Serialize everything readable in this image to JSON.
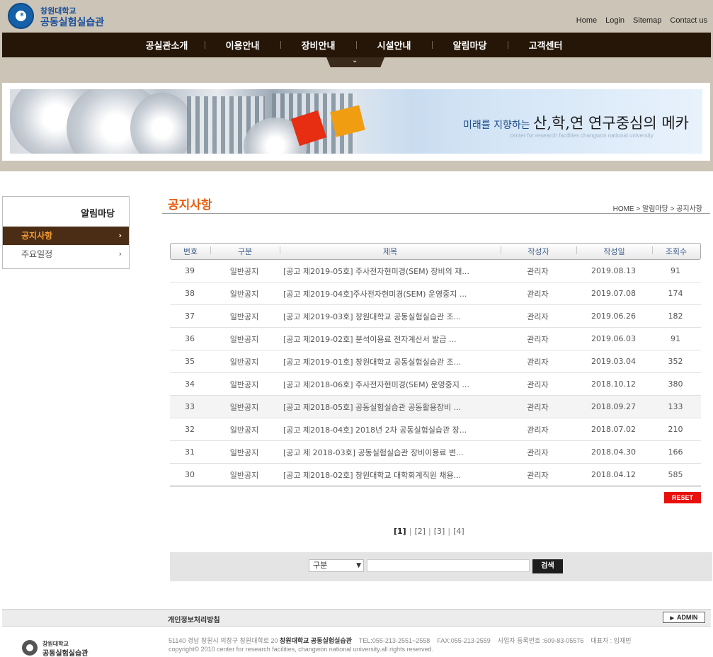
{
  "logo": {
    "line1": "창원대학교",
    "line2": "공동실험실습관"
  },
  "topnav": [
    "Home",
    "Login",
    "Sitemap",
    "Contact us"
  ],
  "gnb": [
    "공실관소개",
    "이용안내",
    "장비안내",
    "시설안내",
    "알림마당",
    "고객센터"
  ],
  "banner": {
    "slogan_small": "미래를 지향하는 ",
    "slogan_big": "산,학,연 연구중심의 메카",
    "sub": "center for research facilities changwon national university"
  },
  "lnb": {
    "title": "알림마당",
    "items": [
      "공지사항",
      "주요일정"
    ]
  },
  "page": {
    "title": "공지사항",
    "breadcrumb": "HOME > 알림마당 > 공지사항"
  },
  "board": {
    "headers": [
      "번호",
      "구분",
      "제목",
      "작성자",
      "작성일",
      "조회수"
    ],
    "rows": [
      [
        "39",
        "일반공지",
        "[공고 제2019-05호] 주사전자현미경(SEM) 장비의 재...",
        "관리자",
        "2019.08.13",
        "91"
      ],
      [
        "38",
        "일반공지",
        "[공고 제2019-04호]주사전자현미경(SEM) 운영중지 ...",
        "관리자",
        "2019.07.08",
        "174"
      ],
      [
        "37",
        "일반공지",
        "[공고 제2019-03호] 창원대학교 공동실험실습관 조...",
        "관리자",
        "2019.06.26",
        "182"
      ],
      [
        "36",
        "일반공지",
        "[공고 제2019-02호] 분석이용료 전자계산서 발급 ...",
        "관리자",
        "2019.06.03",
        "91"
      ],
      [
        "35",
        "일반공지",
        "[공고 제2019-01호] 창원대학교 공동실험실습관 조...",
        "관리자",
        "2019.03.04",
        "352"
      ],
      [
        "34",
        "일반공지",
        "[공고 제2018-06호] 주사전자현미경(SEM) 운영중지 ...",
        "관리자",
        "2018.10.12",
        "380"
      ],
      [
        "33",
        "일반공지",
        "[공고 제2018-05호] 공동실험실습관 공동활용장비 ...",
        "관리자",
        "2018.09.27",
        "133"
      ],
      [
        "32",
        "일반공지",
        "[공고 제2018-04호] 2018년 2차 공동실험실습관 장...",
        "관리자",
        "2018.07.02",
        "210"
      ],
      [
        "31",
        "일반공지",
        "[공고 제 2018-03호] 공동실험실습관 장비이용료 변...",
        "관리자",
        "2018.04.30",
        "166"
      ],
      [
        "30",
        "일반공지",
        "[공고 제2018-02호] 창원대학교 대학회계직원 채용...",
        "관리자",
        "2018.04.12",
        "585"
      ]
    ],
    "reset_label": "RESET"
  },
  "paging": {
    "current": "[1]",
    "pages": [
      "[2]",
      "[3]",
      "[4]"
    ],
    "separator": "|"
  },
  "search": {
    "select_value": "구분",
    "input_value": "",
    "button": "검색"
  },
  "footer": {
    "privacy": "개인정보처리방침",
    "admin": "ADMIN",
    "logo_line1": "창원대학교",
    "logo_line2": "공동실험실습관",
    "address": "51140 경남 창원시 의창구 창원대학로 20",
    "org": "창원대학교 공동실험실습관",
    "tel": "TEL:055-213-2551~2558",
    "fax": "FAX:055-213-2559",
    "bizno": "사업자 등록번호 :609-83-05576",
    "ceo": "대표자 : 임재민",
    "copyright": "copyright© 2010 center for research facilities, changwon national university.all rights reserved."
  },
  "colors": {
    "accent": "#e85c0d",
    "gnb_bg": "#251608",
    "header_bg": "#ccc4b6",
    "active_menu_bg": "#4a2d14",
    "reset_red": "#e8100c"
  }
}
